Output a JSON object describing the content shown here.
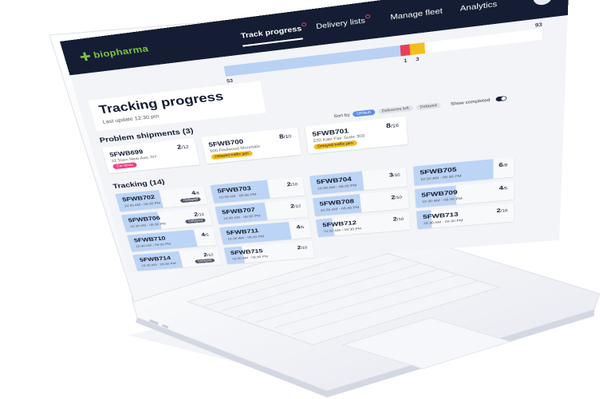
{
  "app": {
    "logo_text": "biopharma",
    "accent": "#7cc242",
    "nav_bg": "#141d33",
    "avatar_initials": "BL"
  },
  "nav": {
    "tabs": [
      {
        "label": "Track progress",
        "active": true
      },
      {
        "label": "Delivery lists",
        "active": false
      },
      {
        "label": "Manage fleet",
        "active": false
      },
      {
        "label": "Analytics",
        "active": false
      }
    ]
  },
  "progress": {
    "completed": 53,
    "red": 1,
    "yellow": 3,
    "total": 93,
    "label_completed": "53",
    "label_red": "1",
    "label_yellow": "3",
    "label_total": "93"
  },
  "header": {
    "title": "Tracking progress",
    "last_update": "Last update 12:30 pm"
  },
  "problem_section": {
    "title": "Problem shipments (3)",
    "items": [
      {
        "id": "5FWB699",
        "done": "2",
        "total": "/12",
        "address": "32 Town Near Ave, NY",
        "badge": "Car delay",
        "badge_color": "#f13c83"
      },
      {
        "id": "5FWB700",
        "done": "8",
        "total": "/10",
        "address": "900 Redwood Mountain",
        "badge": "Delayed traffic jam",
        "badge_color": "#f6bd1a"
      },
      {
        "id": "5FWB701",
        "done": "8",
        "total": "/16",
        "address": "220 Kaki Fair Suite 300",
        "badge": "Delayed traffic jam",
        "badge_color": "#f6bd1a"
      }
    ]
  },
  "sort": {
    "label": "Sort by",
    "options": [
      "Default",
      "Deliveries left",
      "Delayed"
    ],
    "selected": "Default",
    "show_completed_label": "Show completed"
  },
  "tracking_section": {
    "title": "Tracking (14)",
    "items": [
      {
        "id": "5FWB702",
        "done": "4",
        "total": "/8",
        "time": "10:30 AM - 06:30 PM",
        "badge": "Delayed",
        "progress": 0.5
      },
      {
        "id": "5FWB703",
        "done": "2",
        "total": "/10",
        "time": "10:30 AM - 06:30 PM",
        "badge": "",
        "progress": 0.62
      },
      {
        "id": "5FWB704",
        "done": "3",
        "total": "/10",
        "time": "10:30 AM - 06:30 PM",
        "badge": "",
        "progress": 0.55
      },
      {
        "id": "5FWB705",
        "done": "6",
        "total": "/8",
        "time": "10:30 AM - 06:30 PM",
        "badge": "",
        "progress": 0.8
      },
      {
        "id": "5FWB706",
        "done": "2",
        "total": "/12",
        "time": "10:30 AM - 06:30 PM",
        "badge": "Delayed",
        "progress": 0.42
      },
      {
        "id": "5FWB707",
        "done": "2",
        "total": "/12",
        "time": "10:30 AM - 06:30 PM",
        "badge": "",
        "progress": 0.55
      },
      {
        "id": "5FWB708",
        "done": "2",
        "total": "/10",
        "time": "10:30 AM - 06:30 PM",
        "badge": "",
        "progress": 0.5
      },
      {
        "id": "5FWB709",
        "done": "4",
        "total": "/5",
        "time": "10:30 AM - 06:30 PM",
        "badge": "",
        "progress": 0.42
      },
      {
        "id": "5FWB710",
        "done": "4",
        "total": "/5",
        "time": "10:30 AM - 06:30 PM",
        "badge": "",
        "progress": 0.78
      },
      {
        "id": "5FWB711",
        "done": "4",
        "total": "/5",
        "time": "10:30 AM - 06:30 PM",
        "badge": "",
        "progress": 0.78
      },
      {
        "id": "5FWB712",
        "done": "2",
        "total": "/10",
        "time": "10:30 AM - 06:30 PM",
        "badge": "",
        "progress": 0.18
      },
      {
        "id": "5FWB713",
        "done": "2",
        "total": "/10",
        "time": "10:30 AM - 06:30 PM",
        "badge": "",
        "progress": 0.15
      },
      {
        "id": "5FWB714",
        "done": "2",
        "total": "/12",
        "time": "10:30 AM - 06:30 PM",
        "badge": "Delayed",
        "progress": 0.55
      },
      {
        "id": "5FWB715",
        "done": "2",
        "total": "/10",
        "time": "10:30 AM - 06:30 PM",
        "badge": "",
        "progress": 0.2
      }
    ]
  }
}
